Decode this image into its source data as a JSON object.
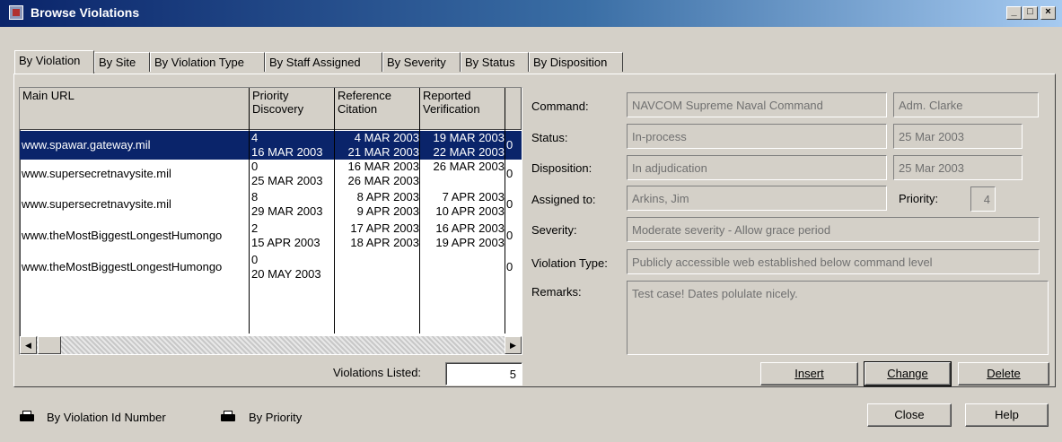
{
  "window": {
    "title": "Browse Violations"
  },
  "tabs": [
    "By Violation",
    "By Site",
    "By Violation Type",
    "By Staff Assigned",
    "By Severity",
    "By Status",
    "By Disposition"
  ],
  "grid": {
    "headers": [
      {
        "line1": "Main URL",
        "line2": ""
      },
      {
        "line1": "Priority",
        "line2": "Discovery"
      },
      {
        "line1": "Reference",
        "line2": "Citation"
      },
      {
        "line1": "Reported",
        "line2": "Verification"
      }
    ],
    "rows": [
      {
        "url": "www.spawar.gateway.mil",
        "priority": "4",
        "discovery": "16 MAR 2003",
        "reference": "4 MAR 2003",
        "citation": "21 MAR 2003",
        "reported": "19 MAR 2003",
        "verification": "22 MAR 2003",
        "extra": "0"
      },
      {
        "url": "www.supersecretnavysite.mil",
        "priority": "0",
        "discovery": "25 MAR 2003",
        "reference": "16 MAR 2003",
        "citation": "26 MAR 2003",
        "reported": "26 MAR 2003",
        "verification": "",
        "extra": "0"
      },
      {
        "url": "www.supersecretnavysite.mil",
        "priority": "8",
        "discovery": "29 MAR 2003",
        "reference": "8 APR 2003",
        "citation": "9 APR 2003",
        "reported": "7 APR 2003",
        "verification": "10 APR 2003",
        "extra": "0"
      },
      {
        "url": "www.theMostBiggestLongestHumongo",
        "priority": "2",
        "discovery": "15 APR 2003",
        "reference": "17 APR 2003",
        "citation": "18 APR 2003",
        "reported": "16 APR 2003",
        "verification": "19 APR 2003",
        "extra": "0"
      },
      {
        "url": "www.theMostBiggestLongestHumongo",
        "priority": "0",
        "discovery": "20 MAY 2003",
        "reference": "",
        "citation": "",
        "reported": "",
        "verification": "",
        "extra": "0"
      }
    ]
  },
  "listed": {
    "label": "Violations Listed:",
    "value": "5"
  },
  "details": {
    "command_label": "Command:",
    "command": "NAVCOM Supreme Naval Command",
    "command_person": "Adm. Clarke",
    "status_label": "Status:",
    "status": "In-process",
    "status_date": "25 Mar 2003",
    "disposition_label": "Disposition:",
    "disposition": "In adjudication",
    "disposition_date": "25 Mar 2003",
    "assigned_label": "Assigned to:",
    "assigned": "Arkins, Jim",
    "priority_label": "Priority:",
    "priority": "4",
    "severity_label": "Severity:",
    "severity": "Moderate severity - Allow grace period",
    "type_label": "Violation Type:",
    "type": "Publicly accessible web established below command level",
    "remarks_label": "Remarks:",
    "remarks": "Test case! Dates polulate nicely."
  },
  "actions": {
    "insert": "Insert",
    "change": "Change",
    "delete": "Delete"
  },
  "footer": {
    "print_id": "By Violation Id Number",
    "print_priority": "By Priority",
    "close": "Close",
    "help": "Help"
  }
}
